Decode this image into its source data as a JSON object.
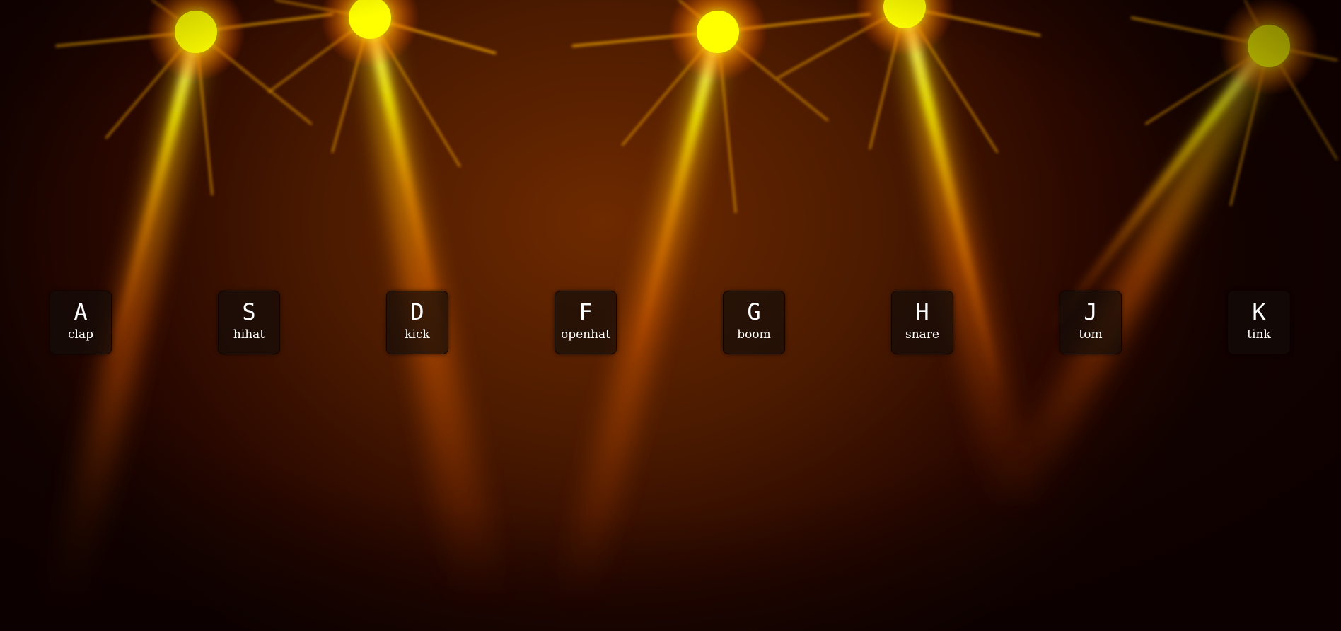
{
  "colors": {
    "background_dark": "#140200",
    "background_mid": "#6e2a00",
    "light_core": "#ffff00",
    "light_beam": "#ff8000",
    "key_bg": "#1a0f0a",
    "key_text": "#ffffff"
  },
  "keys": [
    {
      "key": "A",
      "sound": "clap"
    },
    {
      "key": "S",
      "sound": "hihat"
    },
    {
      "key": "D",
      "sound": "kick"
    },
    {
      "key": "F",
      "sound": "openhat"
    },
    {
      "key": "G",
      "sound": "boom"
    },
    {
      "key": "H",
      "sound": "snare"
    },
    {
      "key": "J",
      "sound": "tom"
    },
    {
      "key": "K",
      "sound": "tink"
    }
  ]
}
